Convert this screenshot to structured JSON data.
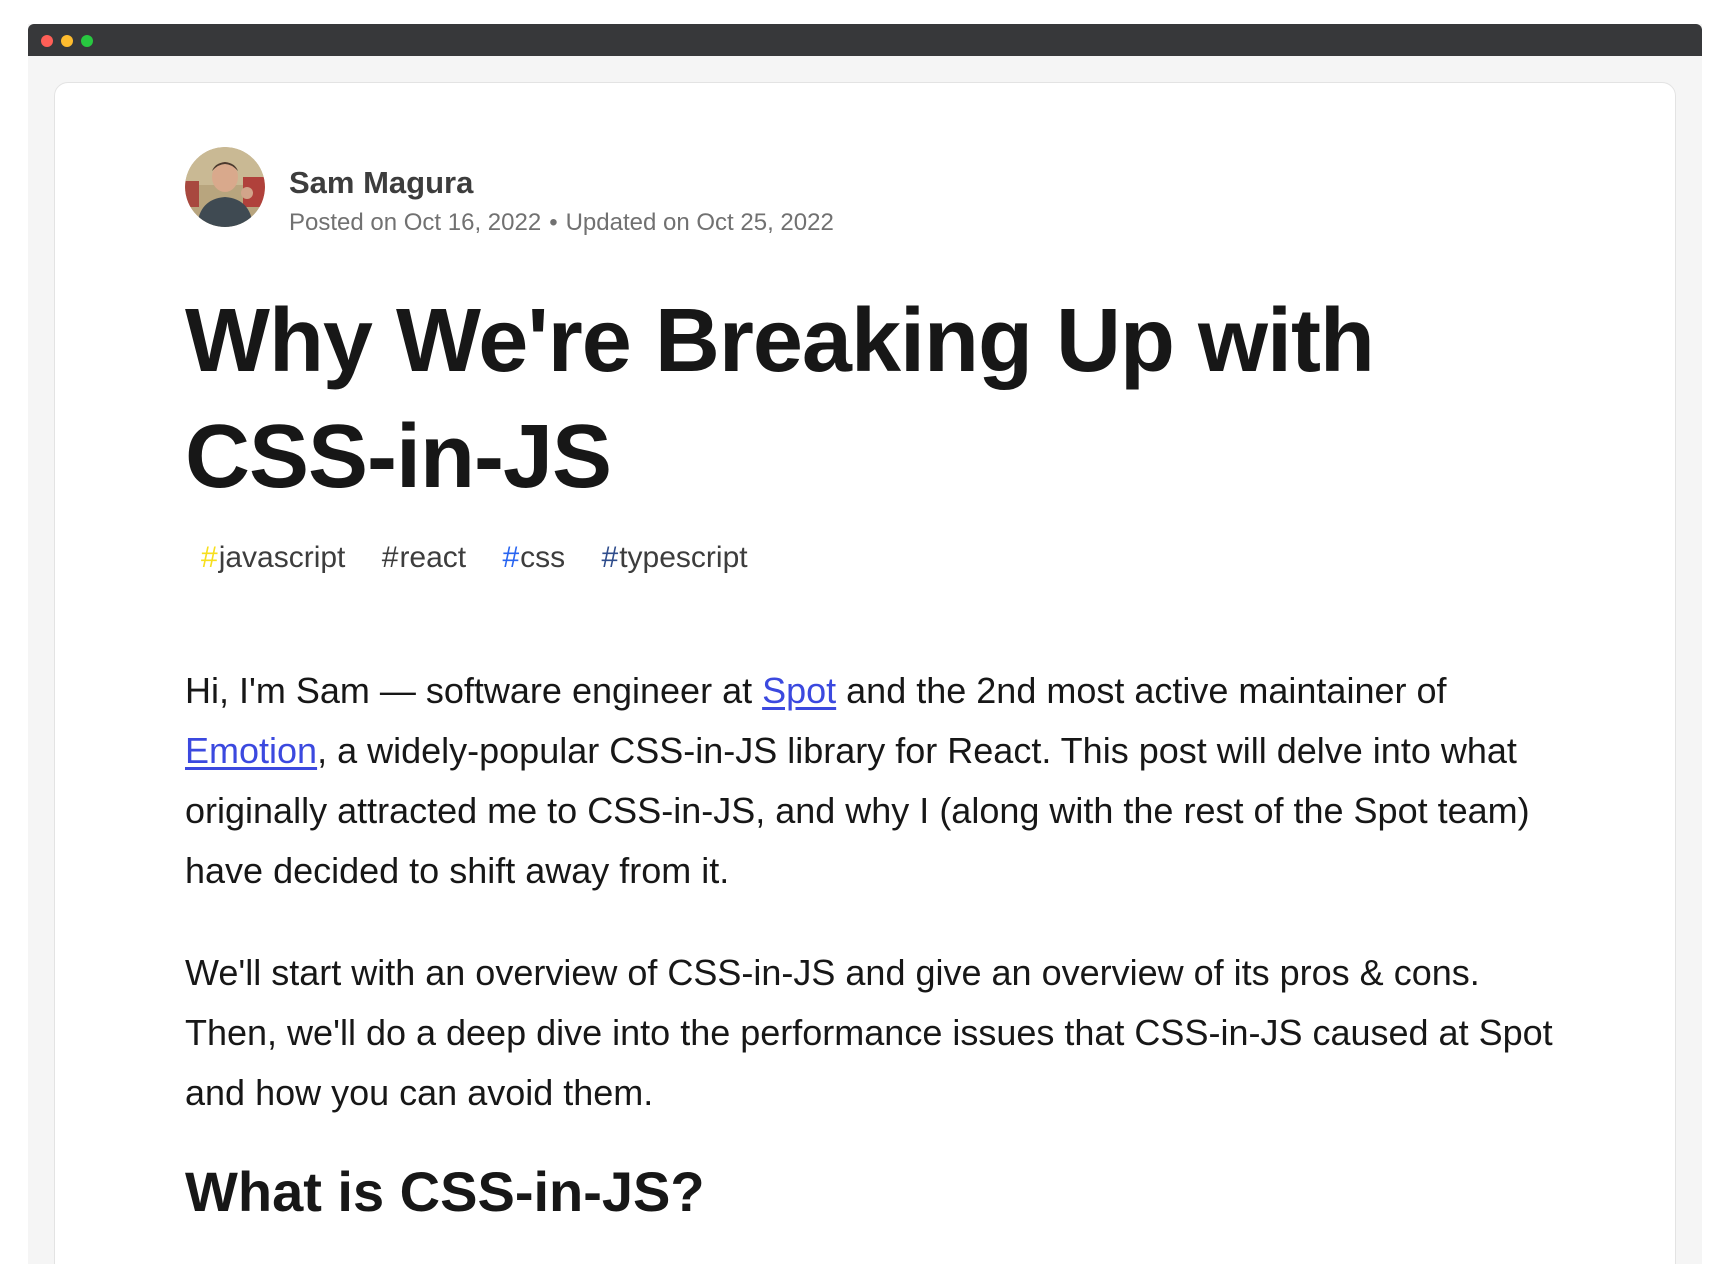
{
  "window": {
    "controls": [
      "close",
      "minimize",
      "zoom"
    ]
  },
  "author": {
    "name": "Sam Magura",
    "posted": "Posted on Oct 16, 2022",
    "separator": "•",
    "updated": "Updated on Oct 25, 2022",
    "avatar_icon": "profile-photo"
  },
  "article": {
    "title": "Why We're Breaking Up with CSS-in-JS",
    "tags": [
      {
        "hash": "#",
        "name": "javascript",
        "hash_color": "#f7df1e"
      },
      {
        "hash": "#",
        "name": "react",
        "hash_color": "#3d3d3d"
      },
      {
        "hash": "#",
        "name": "css",
        "hash_color": "#2965f1"
      },
      {
        "hash": "#",
        "name": "typescript",
        "hash_color": "#2f4d8c"
      }
    ],
    "p1": {
      "t1": "Hi, I'm Sam — software engineer at ",
      "link1": "Spot",
      "t2": " and the 2nd most active maintainer of ",
      "link2": "Emotion",
      "t3": ", a widely-popular CSS-in-JS library for React. This post will delve into what originally attracted me to CSS-in-JS, and why I (along with the rest of the Spot team) have decided to shift away from it."
    },
    "p2": "We'll start with an overview of CSS-in-JS and give an overview of its pros & cons. Then, we'll do a deep dive into the performance issues that CSS-in-JS caused at Spot and how you can avoid them.",
    "section_heading": "What is CSS-in-JS?"
  },
  "colors": {
    "link": "#3b49df",
    "text": "#171717",
    "meta": "#717171"
  }
}
